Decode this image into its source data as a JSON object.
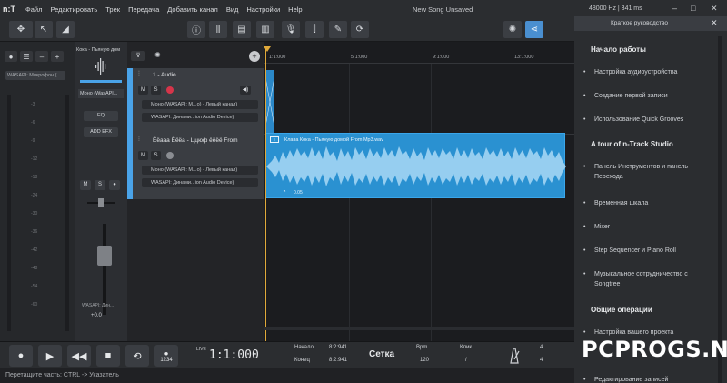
{
  "titlebar": {
    "logo": "n:T",
    "menu": [
      "Файл",
      "Редактировать",
      "Трек",
      "Передача",
      "Добавить канал",
      "Вид",
      "Настройки",
      "Help"
    ],
    "title": "New Song Unsaved",
    "audio_info": "48000 Hz | 341 ms",
    "minimize": "–",
    "maximize": "□",
    "close": "✕"
  },
  "toolbar": {
    "tools": [
      "move-tool",
      "pointer-tool",
      "volume-tool"
    ],
    "center": [
      "info",
      "mixer",
      "track",
      "piano",
      "metronome",
      "tuner",
      "edit",
      "loop"
    ],
    "right": [
      "gear",
      "share"
    ]
  },
  "mixer": {
    "input_name": "WASAPI: Микрофон (...",
    "meter_scale": [
      "-3",
      "-6",
      "-9",
      "-12",
      "-18",
      "-24",
      "-30",
      "-36",
      "-42",
      "-48",
      "-54",
      "-60"
    ],
    "channel_name": "Кока - Пьяную дом",
    "channel_mono": "Моно (WasAPI...",
    "eq_label": "EQ",
    "add_efx_label": "ADD EFX",
    "mute_label": "M",
    "solo_label": "S",
    "volume_value": "+0.0",
    "device_label": "WASAPI: Дин..."
  },
  "tracks": [
    {
      "name": "1 - Audio",
      "mute": "M",
      "solo": "S",
      "input": "Моно (WASAPI: M...o) - Левый канал)",
      "output": "WASAPI: Динами...ion Audio Device)"
    },
    {
      "name": "Ёёааа Ёёёа - Ццюф ёёёё From",
      "mute": "M",
      "solo": "S",
      "input": "Моно (WASAPI: M...o) - Левый канал)",
      "output": "WASAPI: Динами...ion Audio Device)"
    }
  ],
  "timeline": {
    "ruler": [
      "1:1:000",
      "5:1:000",
      "9:1:000",
      "13:1:000"
    ],
    "clip_name": "Клава Кока - Пьяную домой From Mp3.wav",
    "clip_gain": "0.05"
  },
  "guide": {
    "title": "Краткое руководство",
    "close": "✕",
    "sections": [
      {
        "heading": "Начало работы",
        "items": [
          "Настройка аудиоустройства",
          "Создание первой записи",
          "Использование Quick Grooves"
        ]
      },
      {
        "heading": "A tour of n-Track Studio",
        "items": [
          "Панель Инструментов и панель Перехода",
          "Временная шкала",
          "Mixer",
          "Step Sequencer и Piano Roll",
          "Музыкальное сотрудничество с Songtree"
        ]
      },
      {
        "heading": "Общие операции",
        "items": [
          "Настройка вашего проекта",
          "Редактирование записей"
        ]
      }
    ]
  },
  "transport": {
    "record_icon": "●",
    "play_icon": "▶",
    "rewind_icon": "◀◀",
    "stop_icon": "■",
    "loop_icon": "⟲",
    "count_label": "1234",
    "live_label": "LIVE",
    "time": "1:1:000",
    "start_label": "Начало",
    "start_value": "8:2:941",
    "end_label": "Конец",
    "end_value": "8:2:941",
    "grid_label": "Сетка",
    "bpm_label": "Bpm",
    "bpm_value": "120",
    "click_label": "Клик",
    "click_value": "/",
    "sig_top": "4",
    "sig_bottom": "4"
  },
  "status": {
    "text": "Перетащите часть: CTRL -> Указатель"
  },
  "watermark": "PCPROGS.NET"
}
